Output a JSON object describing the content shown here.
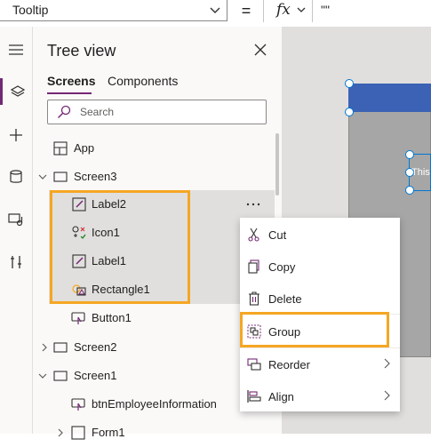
{
  "formula_bar": {
    "property": "Tooltip",
    "equals": "=",
    "fx_label": "fx",
    "formula_value": "\"\""
  },
  "tree_view": {
    "title": "Tree view",
    "tabs": [
      "Screens",
      "Components"
    ],
    "search_placeholder": "Search",
    "items": [
      {
        "label": "App"
      },
      {
        "label": "Screen3"
      },
      {
        "label": "Label2"
      },
      {
        "label": "Icon1"
      },
      {
        "label": "Label1"
      },
      {
        "label": "Rectangle1"
      },
      {
        "label": "Button1"
      },
      {
        "label": "Screen2"
      },
      {
        "label": "Screen1"
      },
      {
        "label": "btnEmployeeInformation"
      },
      {
        "label": "Form1"
      }
    ]
  },
  "canvas": {
    "label_text": "This"
  },
  "context_menu": {
    "items": [
      {
        "label": "Cut",
        "icon": "scissors-icon"
      },
      {
        "label": "Copy",
        "icon": "copy-icon"
      },
      {
        "label": "Delete",
        "icon": "trash-icon"
      },
      {
        "label": "Group",
        "icon": "group-icon"
      },
      {
        "label": "Reorder",
        "icon": "reorder-icon"
      },
      {
        "label": "Align",
        "icon": "align-icon"
      }
    ]
  },
  "colors": {
    "accent": "#742774",
    "highlight": "#f5a623",
    "selection": "#0078d4",
    "header_blue": "#3b62b5"
  }
}
